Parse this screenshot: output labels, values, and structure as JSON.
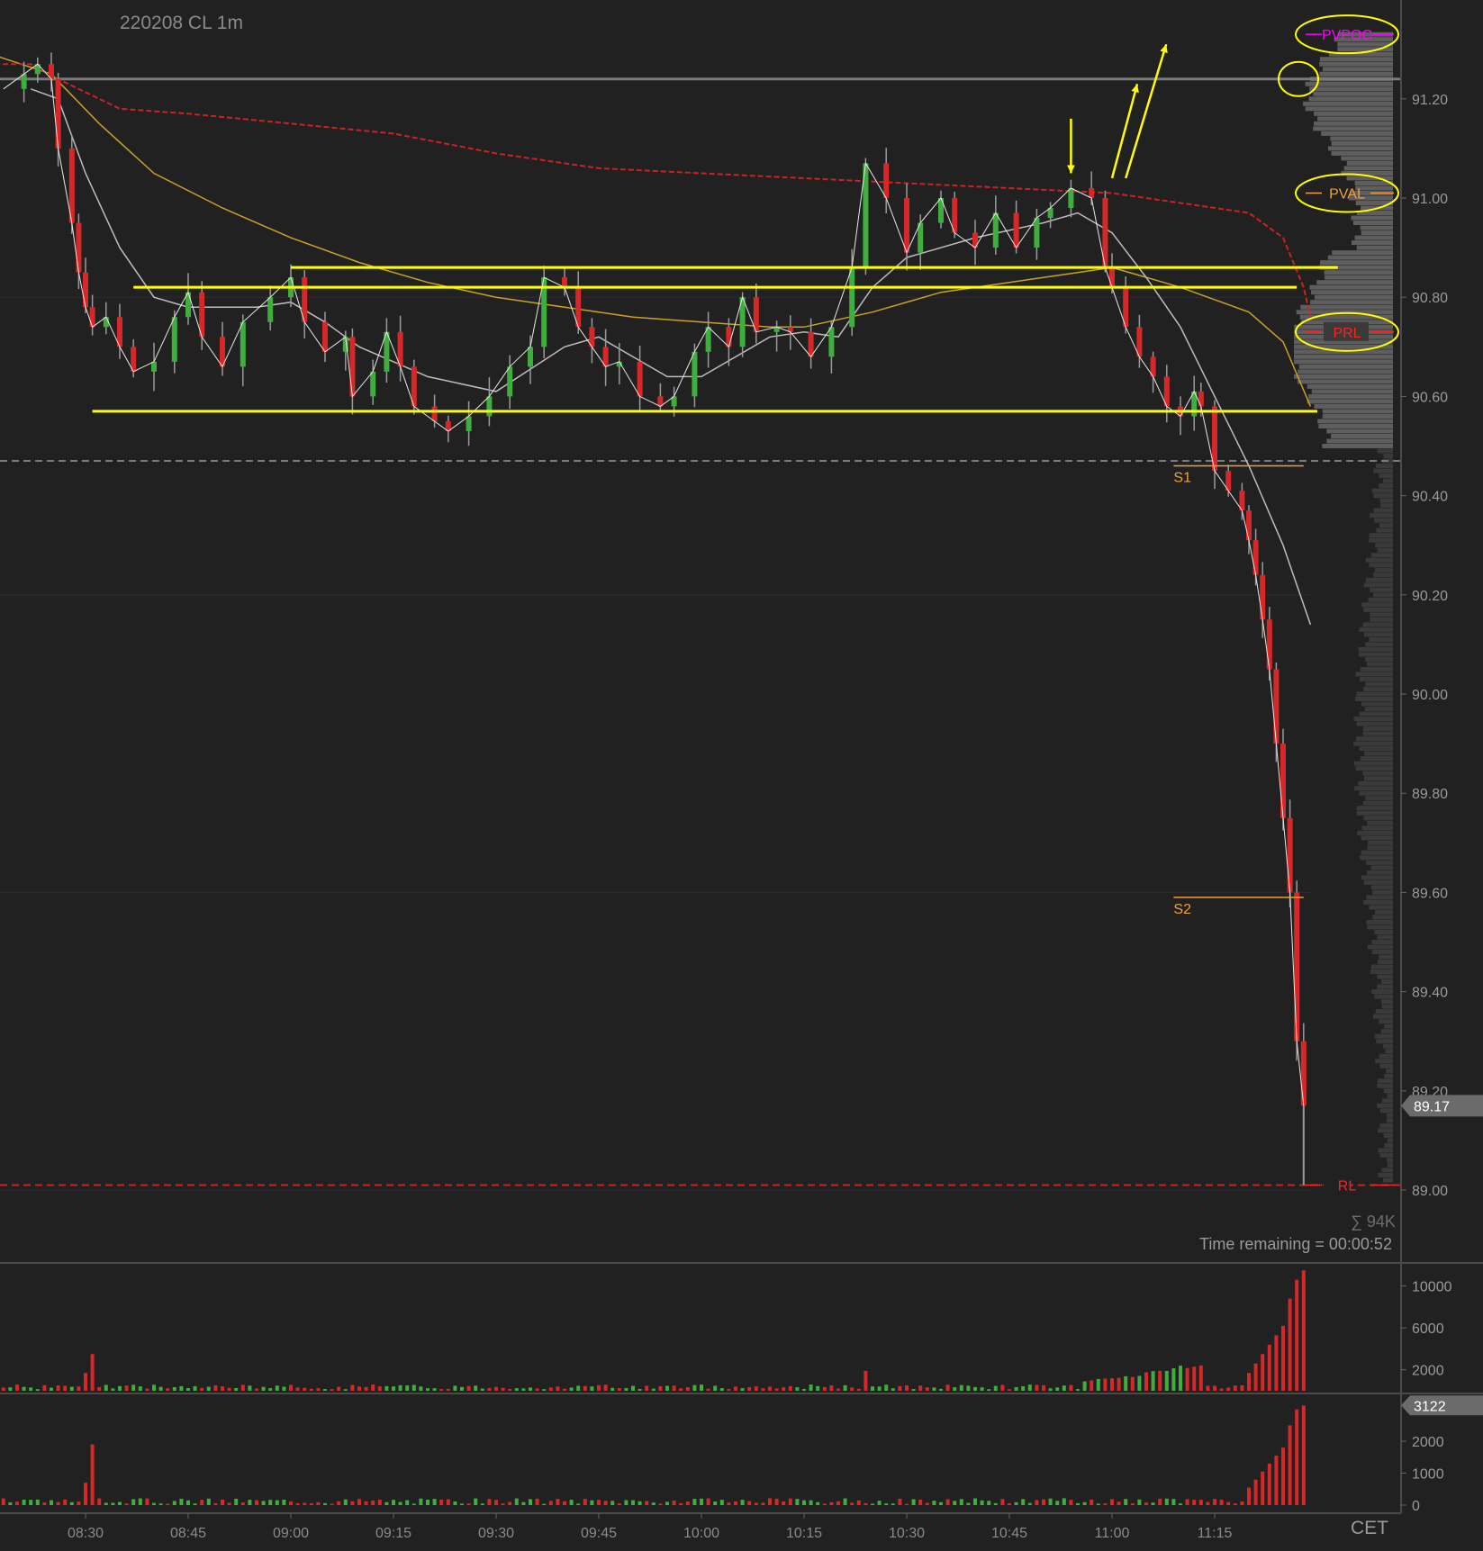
{
  "chart_title": "220208 CL 1m",
  "timezone": "CET",
  "status": {
    "volume_sum": "∑ 94K",
    "time_remaining": "Time remaining = 00:00:52"
  },
  "colors": {
    "background": "#212121",
    "up_candle": "#3fae3f",
    "down_candle": "#d62828",
    "wick": "#9a9a9a",
    "range_lines": "#ffff00",
    "vwap": "#cc2222",
    "ema_slow": "#c9a227",
    "ema_fast": "#bdbdbd",
    "pvpoc": "#ff00ff",
    "pval": "#f0a040",
    "prl": "#ff2020",
    "pivot": "#f0a040",
    "annotation": "#ffff00"
  },
  "chart_data": {
    "type": "candlestick",
    "interval": "1m",
    "x_tick_labels": [
      "08:30",
      "08:45",
      "09:00",
      "09:15",
      "09:30",
      "09:45",
      "10:00",
      "10:15",
      "10:30",
      "10:45",
      "11:00",
      "11:15"
    ],
    "price_axis": {
      "ylim": [
        88.9,
        91.35
      ],
      "ticks": [
        "91.20",
        "91.00",
        "90.80",
        "90.60",
        "90.40",
        "90.20",
        "90.00",
        "89.80",
        "89.60",
        "89.40",
        "89.20",
        "89.00"
      ]
    },
    "last_price": "89.17",
    "price_path": [
      [
        "08:18",
        91.22
      ],
      [
        "08:21",
        91.25
      ],
      [
        "08:23",
        91.27
      ],
      [
        "08:25",
        91.24
      ],
      [
        "08:26",
        91.1
      ],
      [
        "08:28",
        90.95
      ],
      [
        "08:29",
        90.85
      ],
      [
        "08:30",
        90.78
      ],
      [
        "08:31",
        90.74
      ],
      [
        "08:33",
        90.76
      ],
      [
        "08:35",
        90.7
      ],
      [
        "08:37",
        90.65
      ],
      [
        "08:40",
        90.67
      ],
      [
        "08:43",
        90.76
      ],
      [
        "08:45",
        90.81
      ],
      [
        "08:47",
        90.72
      ],
      [
        "08:50",
        90.66
      ],
      [
        "08:53",
        90.75
      ],
      [
        "08:57",
        90.8
      ],
      [
        "09:00",
        90.84
      ],
      [
        "09:02",
        90.75
      ],
      [
        "09:05",
        90.69
      ],
      [
        "09:08",
        90.72
      ],
      [
        "09:09",
        90.6
      ],
      [
        "09:12",
        90.65
      ],
      [
        "09:14",
        90.73
      ],
      [
        "09:16",
        90.66
      ],
      [
        "09:18",
        90.58
      ],
      [
        "09:21",
        90.55
      ],
      [
        "09:23",
        90.53
      ],
      [
        "09:26",
        90.56
      ],
      [
        "09:29",
        90.6
      ],
      [
        "09:32",
        90.66
      ],
      [
        "09:35",
        90.7
      ],
      [
        "09:37",
        90.84
      ],
      [
        "09:40",
        90.82
      ],
      [
        "09:42",
        90.74
      ],
      [
        "09:44",
        90.7
      ],
      [
        "09:46",
        90.66
      ],
      [
        "09:48",
        90.67
      ],
      [
        "09:51",
        90.6
      ],
      [
        "09:54",
        90.58
      ],
      [
        "09:56",
        90.6
      ],
      [
        "09:59",
        90.69
      ],
      [
        "10:01",
        90.74
      ],
      [
        "10:04",
        90.7
      ],
      [
        "10:06",
        90.8
      ],
      [
        "10:08",
        90.73
      ],
      [
        "10:11",
        90.74
      ],
      [
        "10:13",
        90.73
      ],
      [
        "10:16",
        90.68
      ],
      [
        "10:19",
        90.74
      ],
      [
        "10:22",
        90.86
      ],
      [
        "10:24",
        91.07
      ],
      [
        "10:27",
        91.0
      ],
      [
        "10:30",
        90.89
      ],
      [
        "10:32",
        90.95
      ],
      [
        "10:35",
        91.0
      ],
      [
        "10:37",
        90.93
      ],
      [
        "10:40",
        90.9
      ],
      [
        "10:43",
        90.97
      ],
      [
        "10:46",
        90.9
      ],
      [
        "10:49",
        90.96
      ],
      [
        "10:51",
        90.98
      ],
      [
        "10:54",
        91.02
      ],
      [
        "10:57",
        91.0
      ],
      [
        "10:59",
        90.86
      ],
      [
        "11:00",
        90.82
      ],
      [
        "11:02",
        90.74
      ],
      [
        "11:04",
        90.68
      ],
      [
        "11:06",
        90.64
      ],
      [
        "11:08",
        90.58
      ],
      [
        "11:10",
        90.56
      ],
      [
        "11:12",
        90.61
      ],
      [
        "11:13",
        90.58
      ],
      [
        "11:15",
        90.45
      ],
      [
        "11:17",
        90.41
      ],
      [
        "11:19",
        90.37
      ],
      [
        "11:20",
        90.31
      ],
      [
        "11:21",
        90.24
      ],
      [
        "11:22",
        90.15
      ],
      [
        "11:23",
        90.05
      ],
      [
        "11:24",
        89.9
      ],
      [
        "11:25",
        89.75
      ],
      [
        "11:26",
        89.6
      ],
      [
        "11:27",
        89.3
      ],
      [
        "11:28",
        89.17
      ]
    ],
    "last_bar_low": 89.01,
    "indicators": {
      "vwap_dashed": [
        [
          "08:12",
          91.27
        ],
        [
          "08:22",
          91.27
        ],
        [
          "08:26",
          91.24
        ],
        [
          "08:35",
          91.18
        ],
        [
          "08:45",
          91.17
        ],
        [
          "09:00",
          91.15
        ],
        [
          "09:15",
          91.13
        ],
        [
          "09:30",
          91.09
        ],
        [
          "09:45",
          91.06
        ],
        [
          "10:00",
          91.05
        ],
        [
          "10:15",
          91.04
        ],
        [
          "10:30",
          91.03
        ],
        [
          "10:45",
          91.02
        ],
        [
          "11:00",
          91.01
        ],
        [
          "11:10",
          90.99
        ],
        [
          "11:20",
          90.97
        ],
        [
          "11:25",
          90.92
        ],
        [
          "11:28",
          90.82
        ],
        [
          "11:29",
          90.76
        ]
      ],
      "ema_slow": [
        [
          "08:14",
          91.3
        ],
        [
          "08:25",
          91.25
        ],
        [
          "08:32",
          91.15
        ],
        [
          "08:40",
          91.05
        ],
        [
          "08:50",
          90.98
        ],
        [
          "09:00",
          90.92
        ],
        [
          "09:10",
          90.87
        ],
        [
          "09:20",
          90.83
        ],
        [
          "09:30",
          90.8
        ],
        [
          "09:40",
          90.78
        ],
        [
          "09:50",
          90.76
        ],
        [
          "10:00",
          90.75
        ],
        [
          "10:10",
          90.74
        ],
        [
          "10:15",
          90.74
        ],
        [
          "10:25",
          90.77
        ],
        [
          "10:35",
          90.81
        ],
        [
          "10:45",
          90.83
        ],
        [
          "10:55",
          90.85
        ],
        [
          "11:00",
          90.86
        ],
        [
          "11:10",
          90.82
        ],
        [
          "11:20",
          90.77
        ],
        [
          "11:25",
          90.71
        ],
        [
          "11:29",
          90.58
        ]
      ],
      "ema_fast": [
        [
          "08:22",
          91.22
        ],
        [
          "08:26",
          91.2
        ],
        [
          "08:30",
          91.05
        ],
        [
          "08:35",
          90.9
        ],
        [
          "08:40",
          90.8
        ],
        [
          "08:45",
          90.78
        ],
        [
          "08:55",
          90.78
        ],
        [
          "09:00",
          90.79
        ],
        [
          "09:05",
          90.75
        ],
        [
          "09:10",
          90.7
        ],
        [
          "09:20",
          90.64
        ],
        [
          "09:30",
          90.61
        ],
        [
          "09:40",
          90.7
        ],
        [
          "09:45",
          90.72
        ],
        [
          "09:55",
          90.64
        ],
        [
          "10:00",
          90.64
        ],
        [
          "10:10",
          90.72
        ],
        [
          "10:15",
          90.73
        ],
        [
          "10:20",
          90.72
        ],
        [
          "10:25",
          90.82
        ],
        [
          "10:30",
          90.88
        ],
        [
          "10:40",
          90.92
        ],
        [
          "10:50",
          90.95
        ],
        [
          "10:55",
          90.97
        ],
        [
          "11:00",
          90.93
        ],
        [
          "11:05",
          90.84
        ],
        [
          "11:10",
          90.74
        ],
        [
          "11:15",
          90.6
        ],
        [
          "11:20",
          90.46
        ],
        [
          "11:25",
          90.3
        ],
        [
          "11:29",
          90.14
        ]
      ]
    },
    "horizontal_levels": [
      {
        "label": "",
        "price": 91.24,
        "style": "gray-solid"
      },
      {
        "label": "",
        "price": 90.47,
        "style": "gray-dashed"
      },
      {
        "label": "",
        "price": 89.01,
        "style": "red-dashed"
      }
    ],
    "range_lines": [
      {
        "from": "09:00",
        "to": "11:33",
        "price": 90.86
      },
      {
        "from": "08:37",
        "to": "11:27",
        "price": 90.82
      },
      {
        "from": "08:31",
        "to": "11:30",
        "price": 90.57
      }
    ],
    "pivots": [
      {
        "label": "S1",
        "price": 90.46,
        "from": "11:09",
        "to": "11:28"
      },
      {
        "label": "S2",
        "price": 89.59,
        "from": "11:09",
        "to": "11:28"
      }
    ],
    "profile_labels": [
      {
        "label": "PVPOC",
        "price": 91.33
      },
      {
        "label": "PVAL",
        "price": 91.01
      },
      {
        "label": "PRL",
        "price": 90.73
      },
      {
        "label": "RL",
        "price": 89.01
      }
    ],
    "annotations": [
      {
        "type": "arrow-down",
        "at": "10:54",
        "price_from": 91.16,
        "price_to": 91.05
      },
      {
        "type": "arrow-up",
        "at": "11:00",
        "price_from": 91.04,
        "price_to": 91.23
      },
      {
        "type": "arrow-up",
        "at": "11:02",
        "price_from": 91.04,
        "price_to": 91.31
      }
    ],
    "volume_panel": {
      "ticks": [
        "10000",
        "6000",
        "2000"
      ],
      "ylim": [
        0,
        11600
      ],
      "spikes": [
        [
          "08:30",
          1700
        ],
        [
          "08:31",
          3500
        ],
        [
          "10:24",
          1900
        ],
        [
          "11:10",
          2400
        ],
        [
          "11:26",
          8800
        ],
        [
          "11:27",
          10600
        ],
        [
          "11:28",
          11500
        ]
      ]
    },
    "delta_panel": {
      "ticks": [
        "3122",
        "2000",
        "1000",
        "0"
      ],
      "ylim": [
        0,
        3300
      ],
      "current_value": "3122",
      "spikes": [
        [
          "08:30",
          700
        ],
        [
          "08:31",
          1900
        ],
        [
          "11:25",
          1800
        ],
        [
          "11:26",
          2500
        ],
        [
          "11:27",
          3000
        ],
        [
          "11:28",
          3122
        ]
      ]
    }
  }
}
